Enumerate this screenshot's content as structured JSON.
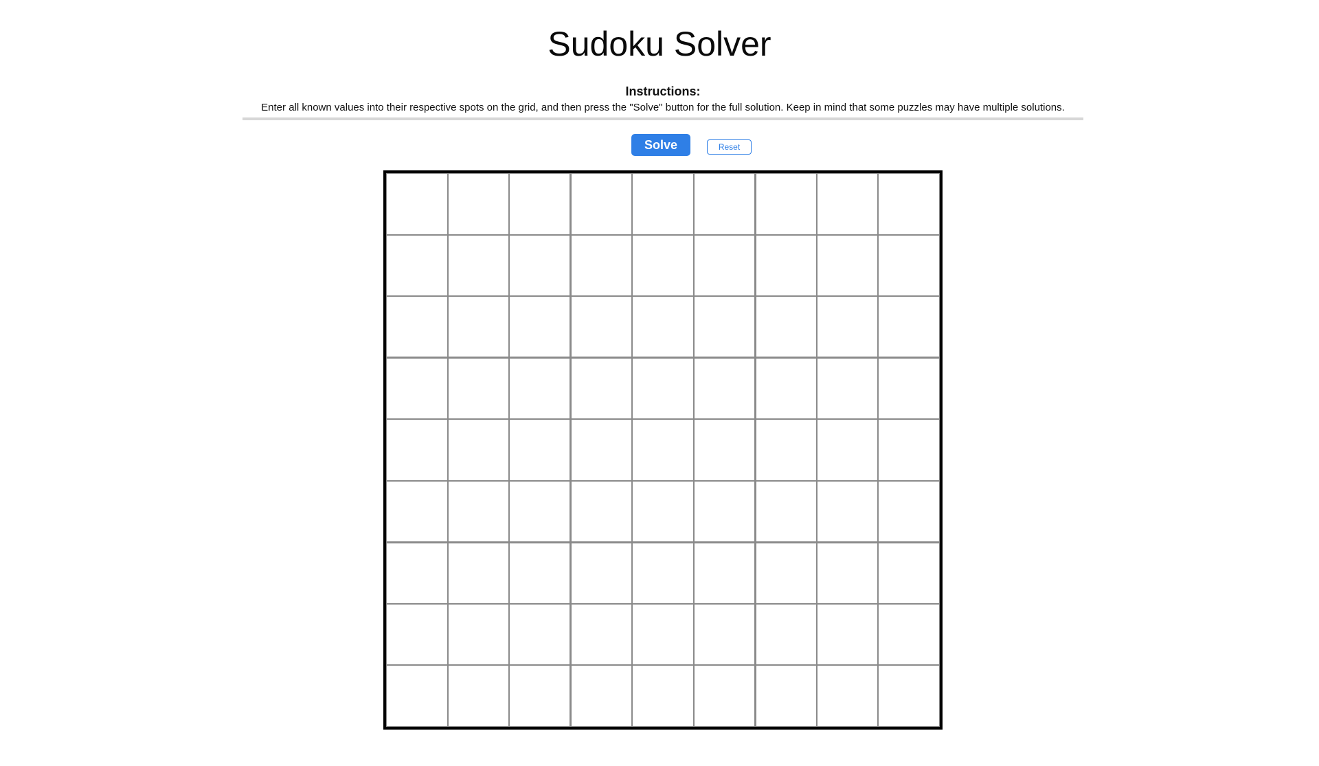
{
  "header": {
    "title": "Sudoku Solver"
  },
  "instructions": {
    "heading": "Instructions:",
    "text": "Enter all known values into their respective spots on the grid, and then press the \"Solve\" button for the full solution. Keep in mind that some puzzles may have multiple solutions."
  },
  "controls": {
    "solve_label": "Solve",
    "reset_label": "Reset"
  },
  "grid": {
    "size": 9,
    "box_size": 3,
    "values": [
      [
        "",
        "",
        "",
        "",
        "",
        "",
        "",
        "",
        ""
      ],
      [
        "",
        "",
        "",
        "",
        "",
        "",
        "",
        "",
        ""
      ],
      [
        "",
        "",
        "",
        "",
        "",
        "",
        "",
        "",
        ""
      ],
      [
        "",
        "",
        "",
        "",
        "",
        "",
        "",
        "",
        ""
      ],
      [
        "",
        "",
        "",
        "",
        "",
        "",
        "",
        "",
        ""
      ],
      [
        "",
        "",
        "",
        "",
        "",
        "",
        "",
        "",
        ""
      ],
      [
        "",
        "",
        "",
        "",
        "",
        "",
        "",
        "",
        ""
      ],
      [
        "",
        "",
        "",
        "",
        "",
        "",
        "",
        "",
        ""
      ],
      [
        "",
        "",
        "",
        "",
        "",
        "",
        "",
        "",
        ""
      ]
    ]
  },
  "colors": {
    "accent": "#2f7fe6",
    "grid_line": "#8a8a8a",
    "board_border": "#000000",
    "divider": "#d7d7d7"
  }
}
